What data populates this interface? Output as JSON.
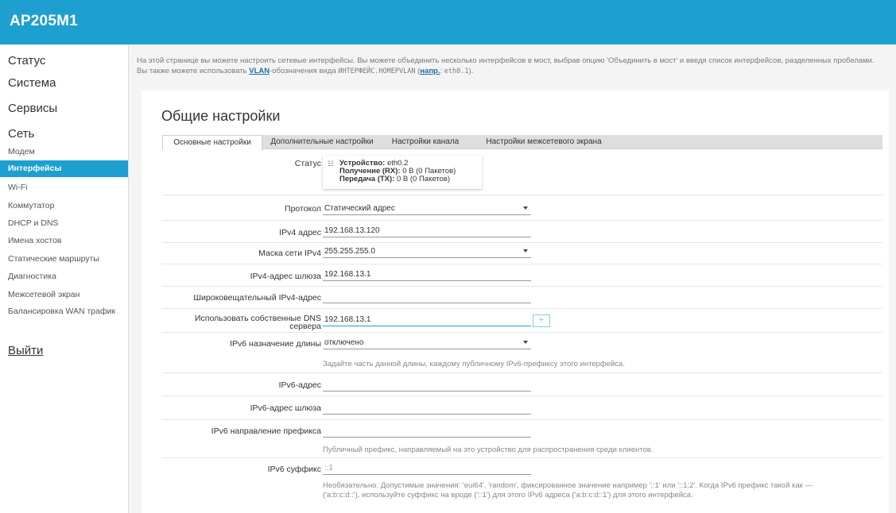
{
  "header": {
    "brand": "AP205M1"
  },
  "sidebar": {
    "top_items": [
      {
        "label": "Статус"
      },
      {
        "label": "Система"
      },
      {
        "label": "Сервисы"
      },
      {
        "label": "Сеть"
      }
    ],
    "sub_items": [
      {
        "label": "Модем"
      },
      {
        "label": "Интерфейсы",
        "active": true
      },
      {
        "label": "Wi-Fi"
      },
      {
        "label": "Коммутатор"
      },
      {
        "label": "DHCP и DNS"
      },
      {
        "label": "Имена хостов"
      },
      {
        "label": "Статические маршруты"
      },
      {
        "label": "Диагностика"
      },
      {
        "label": "Межсетевой экран"
      },
      {
        "label": "Балансировка WAN трафик"
      }
    ],
    "logout": "Выйти"
  },
  "description": {
    "part1": "На этой странице вы можете настроить сетевые интерфейсы. Вы можете объединить несколько интерфейсов в мост, выбрав опцию 'Объединить в мост' и введя список интерфейсов, разделенных пробелами. Вы также можете использовать ",
    "vlan": "VLAN",
    "part2": "-обозначения вида ",
    "mono1": "ИНТЕРФЕЙС.НОМЕРVLAN",
    "part3": " (",
    "example_link": "напр.",
    "part4": ": ",
    "mono2": "eth0.1",
    "part5": ")."
  },
  "card": {
    "title": "Общие настройки",
    "tabs": [
      {
        "label": "Основные настройки",
        "active": true
      },
      {
        "label": "Дополнительные настройки"
      },
      {
        "label": "Настройки канала"
      },
      {
        "label": "Настройки межсетевого экрана"
      }
    ]
  },
  "status": {
    "label": "Статус",
    "device_key": "Устройство:",
    "device_val": " eth0.2",
    "rx_key": "Получение (RX):",
    "rx_val": " 0 B (0 Пакетов)",
    "tx_key": "Передача (TX):",
    "tx_val": " 0 B (0 Пакетов)",
    "icon": "network-port-icon"
  },
  "fields": {
    "protocol": {
      "label": "Протокол",
      "value": "Статический адрес"
    },
    "ipv4_addr": {
      "label": "IPv4 адрес",
      "value": "192.168.13.120"
    },
    "ipv4_mask": {
      "label": "Маска сети IPv4",
      "value": "255.255.255.0"
    },
    "ipv4_gw": {
      "label": "IPv4-адрес шлюза",
      "value": "192.168.13.1"
    },
    "ipv4_bcast": {
      "label": "Широковещательный IPv4-адрес",
      "value": ""
    },
    "dns": {
      "label_line1": "Использовать собственные DNS",
      "label_line2": "сервера",
      "value": "192.168.13.1",
      "add_label": "+"
    },
    "ipv6_len": {
      "label": "IPv6 назначение длины",
      "value": "отключено",
      "hint": "Задайте часть данной длины, каждому публичному IPv6-префиксу этого интерфейса."
    },
    "ipv6_addr": {
      "label": "IPv6-адрес",
      "value": ""
    },
    "ipv6_gw": {
      "label": "IPv6-адрес шлюза",
      "value": ""
    },
    "ipv6_prefix": {
      "label": "IPv6 направление префикса",
      "value": "",
      "hint": "Публичный префикс, направляемый на это устройство для распространения среди клиентов."
    },
    "ipv6_suffix": {
      "label": "IPv6 суффикс",
      "value": "::1",
      "hint1": "Необязательно. Допустимые значения: 'eui64', 'random', фиксированное значение например '::1' или '::1:2'. Когда IPv6 префикс такой как —",
      "hint2": "('a:b:c:d::'), используйте суффикс на вроде ('::1') для этого IPv6 адреса ('a:b:c:d::1') для этого интерфейса."
    }
  }
}
